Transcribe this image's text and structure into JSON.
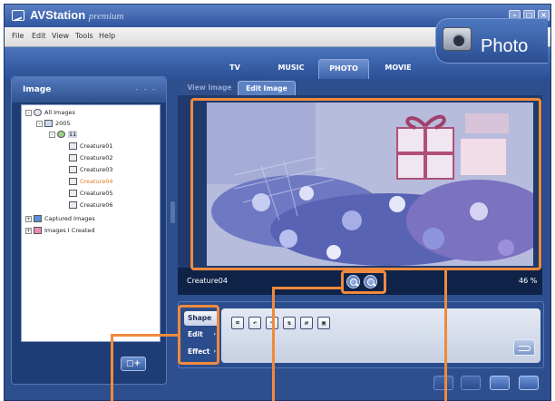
{
  "app": {
    "title": "AVStation",
    "edition": "premium",
    "window_controls": [
      "minimize",
      "maximize",
      "close"
    ]
  },
  "menu": [
    "File",
    "Edit",
    "View",
    "Tools",
    "Help"
  ],
  "mode_tabs": [
    {
      "label": "TV",
      "active": false
    },
    {
      "label": "MUSIC",
      "active": false
    },
    {
      "label": "PHOTO",
      "active": true
    },
    {
      "label": "MOVIE",
      "active": false
    }
  ],
  "section": {
    "title": "Photo",
    "icon": "camera-icon"
  },
  "left_panel": {
    "title": "Image",
    "dots": "- - -",
    "tree": [
      {
        "label": "All Images",
        "level": 0,
        "expander": "-",
        "icon": "disc-icon"
      },
      {
        "label": "2005",
        "level": 1,
        "expander": "-",
        "icon": "calendar-icon"
      },
      {
        "label": "11",
        "level": 2,
        "expander": "-",
        "icon": "calendar-day-icon"
      },
      {
        "label": "Creature01",
        "level": 3,
        "icon": "image-file-icon"
      },
      {
        "label": "Creature02",
        "level": 3,
        "icon": "image-file-icon"
      },
      {
        "label": "Creature03",
        "level": 3,
        "icon": "image-file-icon"
      },
      {
        "label": "Creature04",
        "level": 3,
        "icon": "image-file-icon",
        "selected": true
      },
      {
        "label": "Creature05",
        "level": 3,
        "icon": "image-file-icon"
      },
      {
        "label": "Creature06",
        "level": 3,
        "icon": "image-file-icon"
      },
      {
        "label": "Captured Images",
        "level": 0,
        "expander": "+",
        "icon": "capture-icon"
      },
      {
        "label": "Images I Created",
        "level": 0,
        "expander": "+",
        "icon": "book-icon"
      }
    ],
    "new_button_icon": "new-page-icon",
    "new_button_text": "+"
  },
  "view_tabs": [
    {
      "label": "View Image",
      "active": false
    },
    {
      "label": "Edit Image",
      "active": true
    }
  ],
  "viewer": {
    "photo_name": "Creature04",
    "zoom_percent": "46 %",
    "zoom_in_icon": "zoom-in-icon",
    "zoom_out_icon": "zoom-out-icon"
  },
  "edit_categories": [
    {
      "label": "Shape",
      "active": true
    },
    {
      "label": "Edit",
      "active": false,
      "arrow": "›"
    },
    {
      "label": "Effect",
      "active": false,
      "arrow": "›"
    }
  ],
  "shape_tools": [
    {
      "icon": "crop-icon",
      "glyph": "⌗"
    },
    {
      "icon": "rotate-left-icon",
      "glyph": "↶"
    },
    {
      "icon": "rotate-right-icon",
      "glyph": "↷"
    },
    {
      "icon": "flip-vertical-icon",
      "glyph": "⇅"
    },
    {
      "icon": "flip-horizontal-icon",
      "glyph": "⇄"
    },
    {
      "icon": "resize-icon",
      "glyph": "▣"
    }
  ],
  "bottom_actions": [
    "print-icon",
    "export-icon",
    "save-icon",
    "email-icon"
  ],
  "colors": {
    "highlight": "#f08a3c",
    "frame": "#2d4f8e",
    "selected_item": "#e07a1f"
  }
}
